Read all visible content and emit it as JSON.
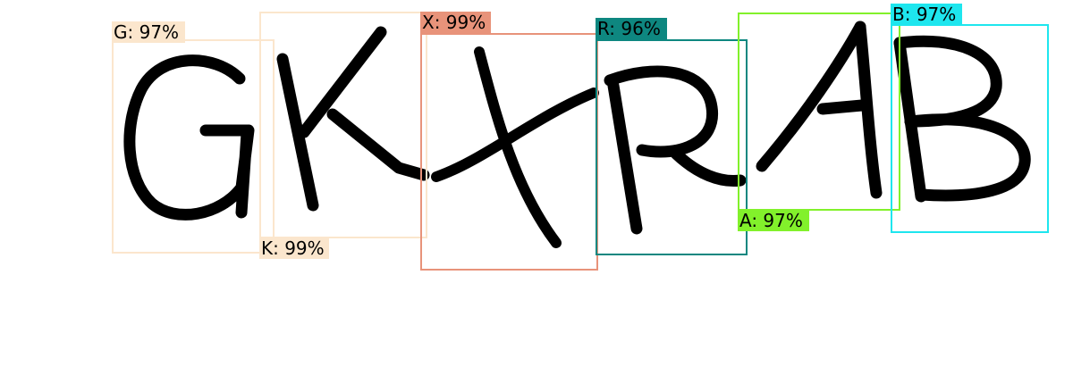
{
  "captcha": {
    "letters": [
      "G",
      "K",
      "X",
      "R",
      "A",
      "B"
    ],
    "ink_color": "#000000"
  },
  "detections": [
    {
      "text": "G: 97%",
      "char": "G",
      "confidence": 0.97,
      "color": "#fbe6cd",
      "label_text_color": "#000000",
      "icon": "bounding-box"
    },
    {
      "text": "K: 99%",
      "char": "K",
      "confidence": 0.99,
      "color": "#fbe6cd",
      "label_text_color": "#000000",
      "icon": "bounding-box"
    },
    {
      "text": "X: 99%",
      "char": "X",
      "confidence": 0.99,
      "color": "#e8937a",
      "label_text_color": "#000000",
      "icon": "bounding-box"
    },
    {
      "text": "R: 96%",
      "char": "R",
      "confidence": 0.96,
      "color": "#0e8780",
      "label_text_color": "#000000",
      "icon": "bounding-box"
    },
    {
      "text": "A: 97%",
      "char": "A",
      "confidence": 0.97,
      "color": "#82f12b",
      "label_text_color": "#000000",
      "icon": "bounding-box"
    },
    {
      "text": "B: 97%",
      "char": "B",
      "confidence": 0.97,
      "color": "#1ee6ee",
      "label_text_color": "#000000",
      "icon": "bounding-box"
    }
  ]
}
